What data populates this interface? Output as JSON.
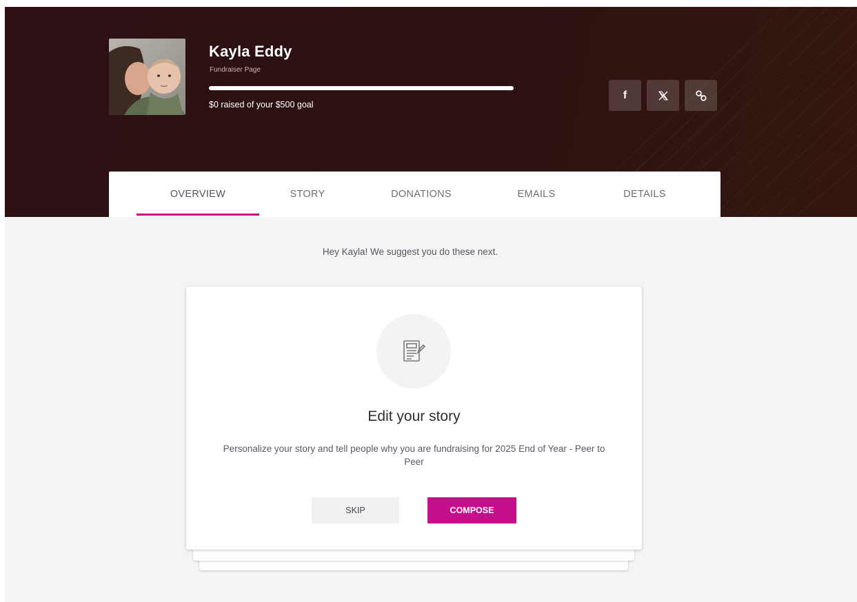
{
  "profile": {
    "name": "Kayla Eddy",
    "subtitle": "Fundraiser Page",
    "raised_text": "$0 raised of your $500 goal",
    "progress_fraction": 1.0
  },
  "share": {
    "buttons": [
      {
        "icon": "facebook-icon",
        "glyph": "f"
      },
      {
        "icon": "x-icon",
        "glyph": "𝕏"
      },
      {
        "icon": "link-icon",
        "glyph": "link"
      }
    ]
  },
  "tabs": [
    {
      "label": "OVERVIEW",
      "active": true
    },
    {
      "label": "STORY",
      "active": false
    },
    {
      "label": "DONATIONS",
      "active": false
    },
    {
      "label": "EMAILS",
      "active": false
    },
    {
      "label": "DETAILS",
      "active": false
    }
  ],
  "main": {
    "suggestion": "Hey Kayla! We suggest you do these next."
  },
  "card": {
    "icon": "document-edit-icon",
    "title": "Edit your story",
    "description": "Personalize your story and tell people why you are fundraising for 2025 End of Year - Peer to Peer",
    "skip_label": "SKIP",
    "compose_label": "COMPOSE"
  },
  "colors": {
    "accent": "#c5108b",
    "hero_bg": "#2e1212",
    "page_bg": "#f4f4f4"
  }
}
